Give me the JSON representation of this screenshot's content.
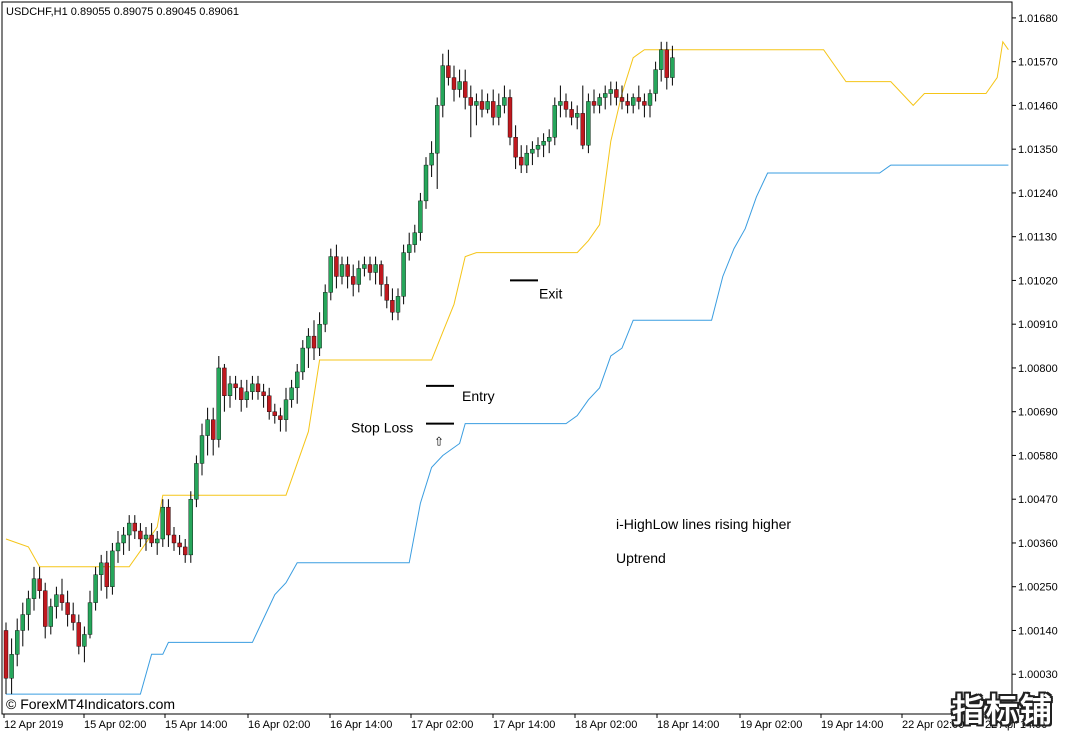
{
  "symbol_header": "USDCHF,H1  0.89055 0.89075 0.89045 0.89061",
  "watermark": "© ForexMT4Indicators.com",
  "corner_logo": "指标铺",
  "colors": {
    "bull": "#26a65b",
    "bear": "#c0191f",
    "wick": "#000000",
    "high_line": "#f5c518",
    "low_line": "#3a9de0",
    "frame": "#000000"
  },
  "chart_data": {
    "type": "candlestick",
    "ylim": [
      0.9993,
      1.0172
    ],
    "y_ticks": [
      "1.01680",
      "1.01570",
      "1.01460",
      "1.01350",
      "1.01240",
      "1.01130",
      "1.01020",
      "1.00910",
      "1.00800",
      "1.00690",
      "1.00580",
      "1.00470",
      "1.00360",
      "1.00250",
      "1.00140",
      "1.00030"
    ],
    "x_ticks": [
      "12 Apr 2019",
      "15 Apr 02:00",
      "15 Apr 14:00",
      "16 Apr 02:00",
      "16 Apr 14:00",
      "17 Apr 02:00",
      "17 Apr 14:00",
      "18 Apr 02:00",
      "18 Apr 14:00",
      "19 Apr 02:00",
      "19 Apr 14:00",
      "22 Apr 02:00",
      "22 Apr 14:00"
    ],
    "candles": [
      [
        1.0014,
        1.0016,
        0.9998,
        1.0002
      ],
      [
        1.0002,
        1.0012,
        0.9998,
        1.0008
      ],
      [
        1.0008,
        1.0017,
        1.0005,
        1.0014
      ],
      [
        1.0014,
        1.0021,
        1.001,
        1.0018
      ],
      [
        1.0018,
        1.0024,
        1.0014,
        1.0022
      ],
      [
        1.0022,
        1.003,
        1.0019,
        1.0027
      ],
      [
        1.0027,
        1.003,
        1.0022,
        1.0024
      ],
      [
        1.0024,
        1.0026,
        1.0012,
        1.0015
      ],
      [
        1.0015,
        1.0022,
        1.0013,
        1.002
      ],
      [
        1.002,
        1.0025,
        1.0017,
        1.0023
      ],
      [
        1.0023,
        1.0027,
        1.0019,
        1.0021
      ],
      [
        1.0021,
        1.0024,
        1.0015,
        1.0018
      ],
      [
        1.0018,
        1.0021,
        1.0014,
        1.0016
      ],
      [
        1.0016,
        1.0018,
        1.0008,
        1.001
      ],
      [
        1.001,
        1.0015,
        1.0006,
        1.0013
      ],
      [
        1.0013,
        1.0024,
        1.0012,
        1.0021
      ],
      [
        1.0021,
        1.003,
        1.0019,
        1.0028
      ],
      [
        1.0028,
        1.0033,
        1.0024,
        1.0031
      ],
      [
        1.0031,
        1.0034,
        1.0022,
        1.0025
      ],
      [
        1.0025,
        1.0036,
        1.0023,
        1.0034
      ],
      [
        1.0034,
        1.0039,
        1.0031,
        1.0036
      ],
      [
        1.0036,
        1.004,
        1.0033,
        1.0038
      ],
      [
        1.0038,
        1.0043,
        1.0034,
        1.0041
      ],
      [
        1.0041,
        1.0043,
        1.0037,
        1.0039
      ],
      [
        1.0039,
        1.0041,
        1.0035,
        1.0037
      ],
      [
        1.0037,
        1.004,
        1.0034,
        1.0038
      ],
      [
        1.0038,
        1.0041,
        1.0035,
        1.0036
      ],
      [
        1.0036,
        1.0039,
        1.0033,
        1.0037
      ],
      [
        1.0037,
        1.0047,
        1.0035,
        1.0045
      ],
      [
        1.0045,
        1.0047,
        1.0035,
        1.0038
      ],
      [
        1.0038,
        1.004,
        1.0034,
        1.0036
      ],
      [
        1.0036,
        1.0038,
        1.0033,
        1.0035
      ],
      [
        1.0035,
        1.0037,
        1.0031,
        1.0033
      ],
      [
        1.0033,
        1.0049,
        1.0031,
        1.0047
      ],
      [
        1.0047,
        1.0058,
        1.0045,
        1.0056
      ],
      [
        1.0056,
        1.0066,
        1.0053,
        1.0063
      ],
      [
        1.0063,
        1.007,
        1.0058,
        1.0067
      ],
      [
        1.0067,
        1.007,
        1.0058,
        1.0062
      ],
      [
        1.0062,
        1.0083,
        1.006,
        1.008
      ],
      [
        1.008,
        1.0081,
        1.0069,
        1.0073
      ],
      [
        1.0073,
        1.0078,
        1.007,
        1.0076
      ],
      [
        1.0076,
        1.0078,
        1.0072,
        1.0075
      ],
      [
        1.0075,
        1.0077,
        1.0069,
        1.0072
      ],
      [
        1.0072,
        1.0077,
        1.007,
        1.0074
      ],
      [
        1.0074,
        1.0078,
        1.0072,
        1.0076
      ],
      [
        1.0076,
        1.0078,
        1.0072,
        1.0074
      ],
      [
        1.0074,
        1.0076,
        1.007,
        1.0073
      ],
      [
        1.0073,
        1.0075,
        1.0067,
        1.0069
      ],
      [
        1.0069,
        1.0071,
        1.0066,
        1.0068
      ],
      [
        1.0068,
        1.007,
        1.0064,
        1.0067
      ],
      [
        1.0067,
        1.0075,
        1.0064,
        1.0072
      ],
      [
        1.0072,
        1.0077,
        1.007,
        1.0075
      ],
      [
        1.0075,
        1.0081,
        1.0071,
        1.0079
      ],
      [
        1.0079,
        1.0087,
        1.0077,
        1.0085
      ],
      [
        1.0085,
        1.009,
        1.008,
        1.0088
      ],
      [
        1.0088,
        1.0092,
        1.0082,
        1.0085
      ],
      [
        1.0085,
        1.0094,
        1.0083,
        1.0091
      ],
      [
        1.0091,
        1.0101,
        1.0089,
        1.0099
      ],
      [
        1.0099,
        1.011,
        1.0097,
        1.0108
      ],
      [
        1.0108,
        1.0111,
        1.01,
        1.0103
      ],
      [
        1.0103,
        1.0108,
        1.0101,
        1.0106
      ],
      [
        1.0106,
        1.0108,
        1.01,
        1.0103
      ],
      [
        1.0103,
        1.0106,
        1.0098,
        1.0101
      ],
      [
        1.0101,
        1.0107,
        1.0099,
        1.0105
      ],
      [
        1.0105,
        1.0108,
        1.0103,
        1.0106
      ],
      [
        1.0106,
        1.0108,
        1.0102,
        1.0104
      ],
      [
        1.0104,
        1.0108,
        1.0101,
        1.0106
      ],
      [
        1.0106,
        1.0107,
        1.0098,
        1.0101
      ],
      [
        1.0101,
        1.0103,
        1.0095,
        1.0097
      ],
      [
        1.0097,
        1.01,
        1.0092,
        1.0094
      ],
      [
        1.0094,
        1.01,
        1.0092,
        1.0098
      ],
      [
        1.0098,
        1.0111,
        1.0096,
        1.0109
      ],
      [
        1.0109,
        1.0114,
        1.0107,
        1.0111
      ],
      [
        1.0111,
        1.0116,
        1.0109,
        1.0114
      ],
      [
        1.0114,
        1.0124,
        1.0112,
        1.0122
      ],
      [
        1.0122,
        1.0133,
        1.012,
        1.0131
      ],
      [
        1.0131,
        1.0137,
        1.0128,
        1.0134
      ],
      [
        1.0134,
        1.0148,
        1.0125,
        1.0146
      ],
      [
        1.0146,
        1.0159,
        1.0143,
        1.0156
      ],
      [
        1.0156,
        1.016,
        1.0151,
        1.0153
      ],
      [
        1.0153,
        1.0156,
        1.0147,
        1.015
      ],
      [
        1.015,
        1.0155,
        1.0148,
        1.0152
      ],
      [
        1.0152,
        1.0155,
        1.0145,
        1.0148
      ],
      [
        1.0148,
        1.0151,
        1.0138,
        1.0146
      ],
      [
        1.0146,
        1.0149,
        1.0141,
        1.0147
      ],
      [
        1.0147,
        1.015,
        1.0143,
        1.0145
      ],
      [
        1.0145,
        1.0149,
        1.0144,
        1.0147
      ],
      [
        1.0147,
        1.015,
        1.0141,
        1.0143
      ],
      [
        1.0143,
        1.0149,
        1.0141,
        1.0146
      ],
      [
        1.0146,
        1.0151,
        1.0144,
        1.0148
      ],
      [
        1.0148,
        1.015,
        1.0136,
        1.0138
      ],
      [
        1.0138,
        1.0141,
        1.013,
        1.0133
      ],
      [
        1.0133,
        1.0136,
        1.0129,
        1.0131
      ],
      [
        1.0131,
        1.0136,
        1.0129,
        1.0134
      ],
      [
        1.0134,
        1.0137,
        1.0131,
        1.0135
      ],
      [
        1.0135,
        1.0138,
        1.0133,
        1.0136
      ],
      [
        1.0136,
        1.0139,
        1.0133,
        1.0137
      ],
      [
        1.0137,
        1.014,
        1.0134,
        1.0138
      ],
      [
        1.0138,
        1.0148,
        1.0136,
        1.0146
      ],
      [
        1.0146,
        1.0151,
        1.0143,
        1.0147
      ],
      [
        1.0147,
        1.0149,
        1.0143,
        1.0145
      ],
      [
        1.0145,
        1.0147,
        1.0141,
        1.0143
      ],
      [
        1.0143,
        1.0146,
        1.014,
        1.0144
      ],
      [
        1.0144,
        1.0151,
        1.0135,
        1.0136
      ],
      [
        1.0136,
        1.0149,
        1.0134,
        1.0147
      ],
      [
        1.0147,
        1.015,
        1.0144,
        1.0146
      ],
      [
        1.0146,
        1.0149,
        1.0144,
        1.0148
      ],
      [
        1.0148,
        1.0151,
        1.0145,
        1.0149
      ],
      [
        1.0149,
        1.0152,
        1.0146,
        1.015
      ],
      [
        1.015,
        1.0152,
        1.0146,
        1.0148
      ],
      [
        1.0148,
        1.0151,
        1.0145,
        1.0147
      ],
      [
        1.0147,
        1.0149,
        1.0144,
        1.0146
      ],
      [
        1.0146,
        1.0149,
        1.0144,
        1.0148
      ],
      [
        1.0148,
        1.0151,
        1.0145,
        1.0147
      ],
      [
        1.0147,
        1.0149,
        1.0143,
        1.0146
      ],
      [
        1.0146,
        1.015,
        1.0143,
        1.0149
      ],
      [
        1.0149,
        1.0157,
        1.0147,
        1.0155
      ],
      [
        1.0155,
        1.0162,
        1.0152,
        1.016
      ],
      [
        1.016,
        1.0162,
        1.015,
        1.0153
      ],
      [
        1.0153,
        1.0161,
        1.0151,
        1.0158
      ]
    ],
    "high_line": [
      [
        0,
        1.0037
      ],
      [
        4,
        1.0035
      ],
      [
        6,
        1.003
      ],
      [
        22,
        1.003
      ],
      [
        24,
        1.0034
      ],
      [
        27,
        1.004
      ],
      [
        28,
        1.0048
      ],
      [
        50,
        1.0048
      ],
      [
        54,
        1.0064
      ],
      [
        56,
        1.0082
      ],
      [
        76,
        1.0082
      ],
      [
        78,
        1.0089
      ],
      [
        80,
        1.0096
      ],
      [
        82,
        1.0108
      ],
      [
        84,
        1.0109
      ],
      [
        102,
        1.0109
      ],
      [
        104,
        1.0112
      ],
      [
        106,
        1.0116
      ],
      [
        108,
        1.0137
      ],
      [
        110,
        1.0149
      ],
      [
        112,
        1.0158
      ],
      [
        114,
        1.016
      ],
      [
        146,
        1.016
      ],
      [
        150,
        1.0152
      ],
      [
        158,
        1.0152
      ],
      [
        162,
        1.0146
      ],
      [
        164,
        1.0149
      ],
      [
        175,
        1.0149
      ],
      [
        177,
        1.0153
      ],
      [
        178,
        1.0162
      ],
      [
        179,
        1.016
      ]
    ],
    "low_line": [
      [
        0,
        0.9998
      ],
      [
        24,
        0.9998
      ],
      [
        26,
        1.0008
      ],
      [
        28,
        1.0008
      ],
      [
        29,
        1.0011
      ],
      [
        44,
        1.0011
      ],
      [
        46,
        1.0017
      ],
      [
        48,
        1.0023
      ],
      [
        50,
        1.0026
      ],
      [
        52,
        1.0031
      ],
      [
        72,
        1.0031
      ],
      [
        74,
        1.0046
      ],
      [
        76,
        1.0055
      ],
      [
        78,
        1.0058
      ],
      [
        81,
        1.0061
      ],
      [
        82,
        1.0066
      ],
      [
        100,
        1.0066
      ],
      [
        102,
        1.0068
      ],
      [
        104,
        1.0072
      ],
      [
        106,
        1.0075
      ],
      [
        108,
        1.0083
      ],
      [
        110,
        1.0085
      ],
      [
        112,
        1.0092
      ],
      [
        126,
        1.0092
      ],
      [
        128,
        1.0103
      ],
      [
        130,
        1.011
      ],
      [
        132,
        1.0115
      ],
      [
        134,
        1.0123
      ],
      [
        136,
        1.0129
      ],
      [
        156,
        1.0129
      ],
      [
        158,
        1.0131
      ],
      [
        179,
        1.0131
      ]
    ],
    "annotations": [
      {
        "text": "Entry",
        "level": 1.00755,
        "bar": 80
      },
      {
        "text": "Stop Loss",
        "level": 1.0066,
        "bar": 80
      },
      {
        "text": "Exit",
        "level": 1.0102,
        "bar": 95
      },
      {
        "text": "i-HighLow lines rising higher"
      },
      {
        "text": "Uptrend"
      }
    ]
  }
}
